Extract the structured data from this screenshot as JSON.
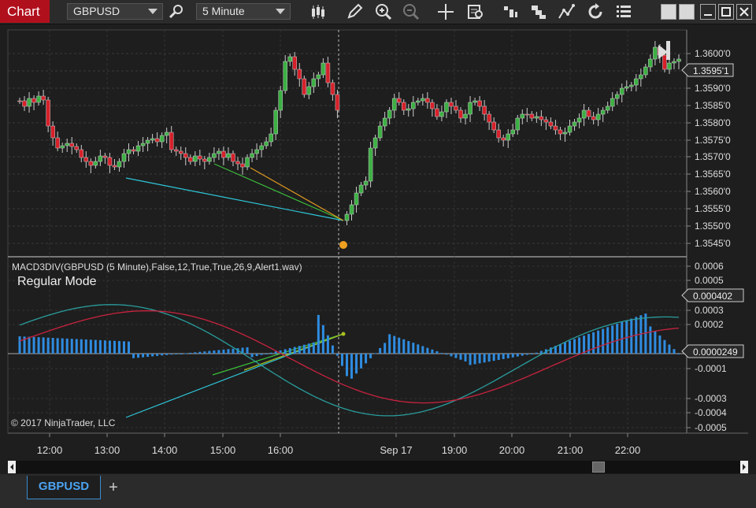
{
  "toolbar": {
    "tab_label": "Chart",
    "instrument": "GBPUSD",
    "interval": "5 Minute"
  },
  "price_panel": {
    "ticks": [
      "1.3600'0",
      "1.3595'0",
      "1.3590'0",
      "1.3585'0",
      "1.3580'0",
      "1.3575'0",
      "1.3570'0",
      "1.3565'0",
      "1.3560'0",
      "1.3555'0",
      "1.3550'0",
      "1.3545'0"
    ],
    "last_price": "1.3595'1"
  },
  "indicator_panel": {
    "label": "MACD3DIV(GBPUSD (5 Minute),False,12,True,True,26,9,Alert1.wav)",
    "mode": "Regular Mode",
    "ticks": [
      "0.0006",
      "0.0005",
      "0.0003",
      "0.0002",
      "-0.0001",
      "-0.0003",
      "-0.0004",
      "-0.0005"
    ],
    "value_macd": "0.000402",
    "value_hist": "0.0000249",
    "copyright": "© 2017 NinjaTrader, LLC"
  },
  "time_axis": [
    "12:00",
    "13:00",
    "14:00",
    "15:00",
    "16:00",
    "Sep 17",
    "19:00",
    "20:00",
    "21:00",
    "22:00"
  ],
  "tabs": {
    "instrument_tab": "GBPUSD",
    "add_tab": "+"
  },
  "colors": {
    "up": "#3cb043",
    "down": "#d6202a",
    "histogram": "#2f8ce0",
    "macd": "#2a9d9d",
    "signal": "#c8233f",
    "accent": "#b0101c"
  }
}
